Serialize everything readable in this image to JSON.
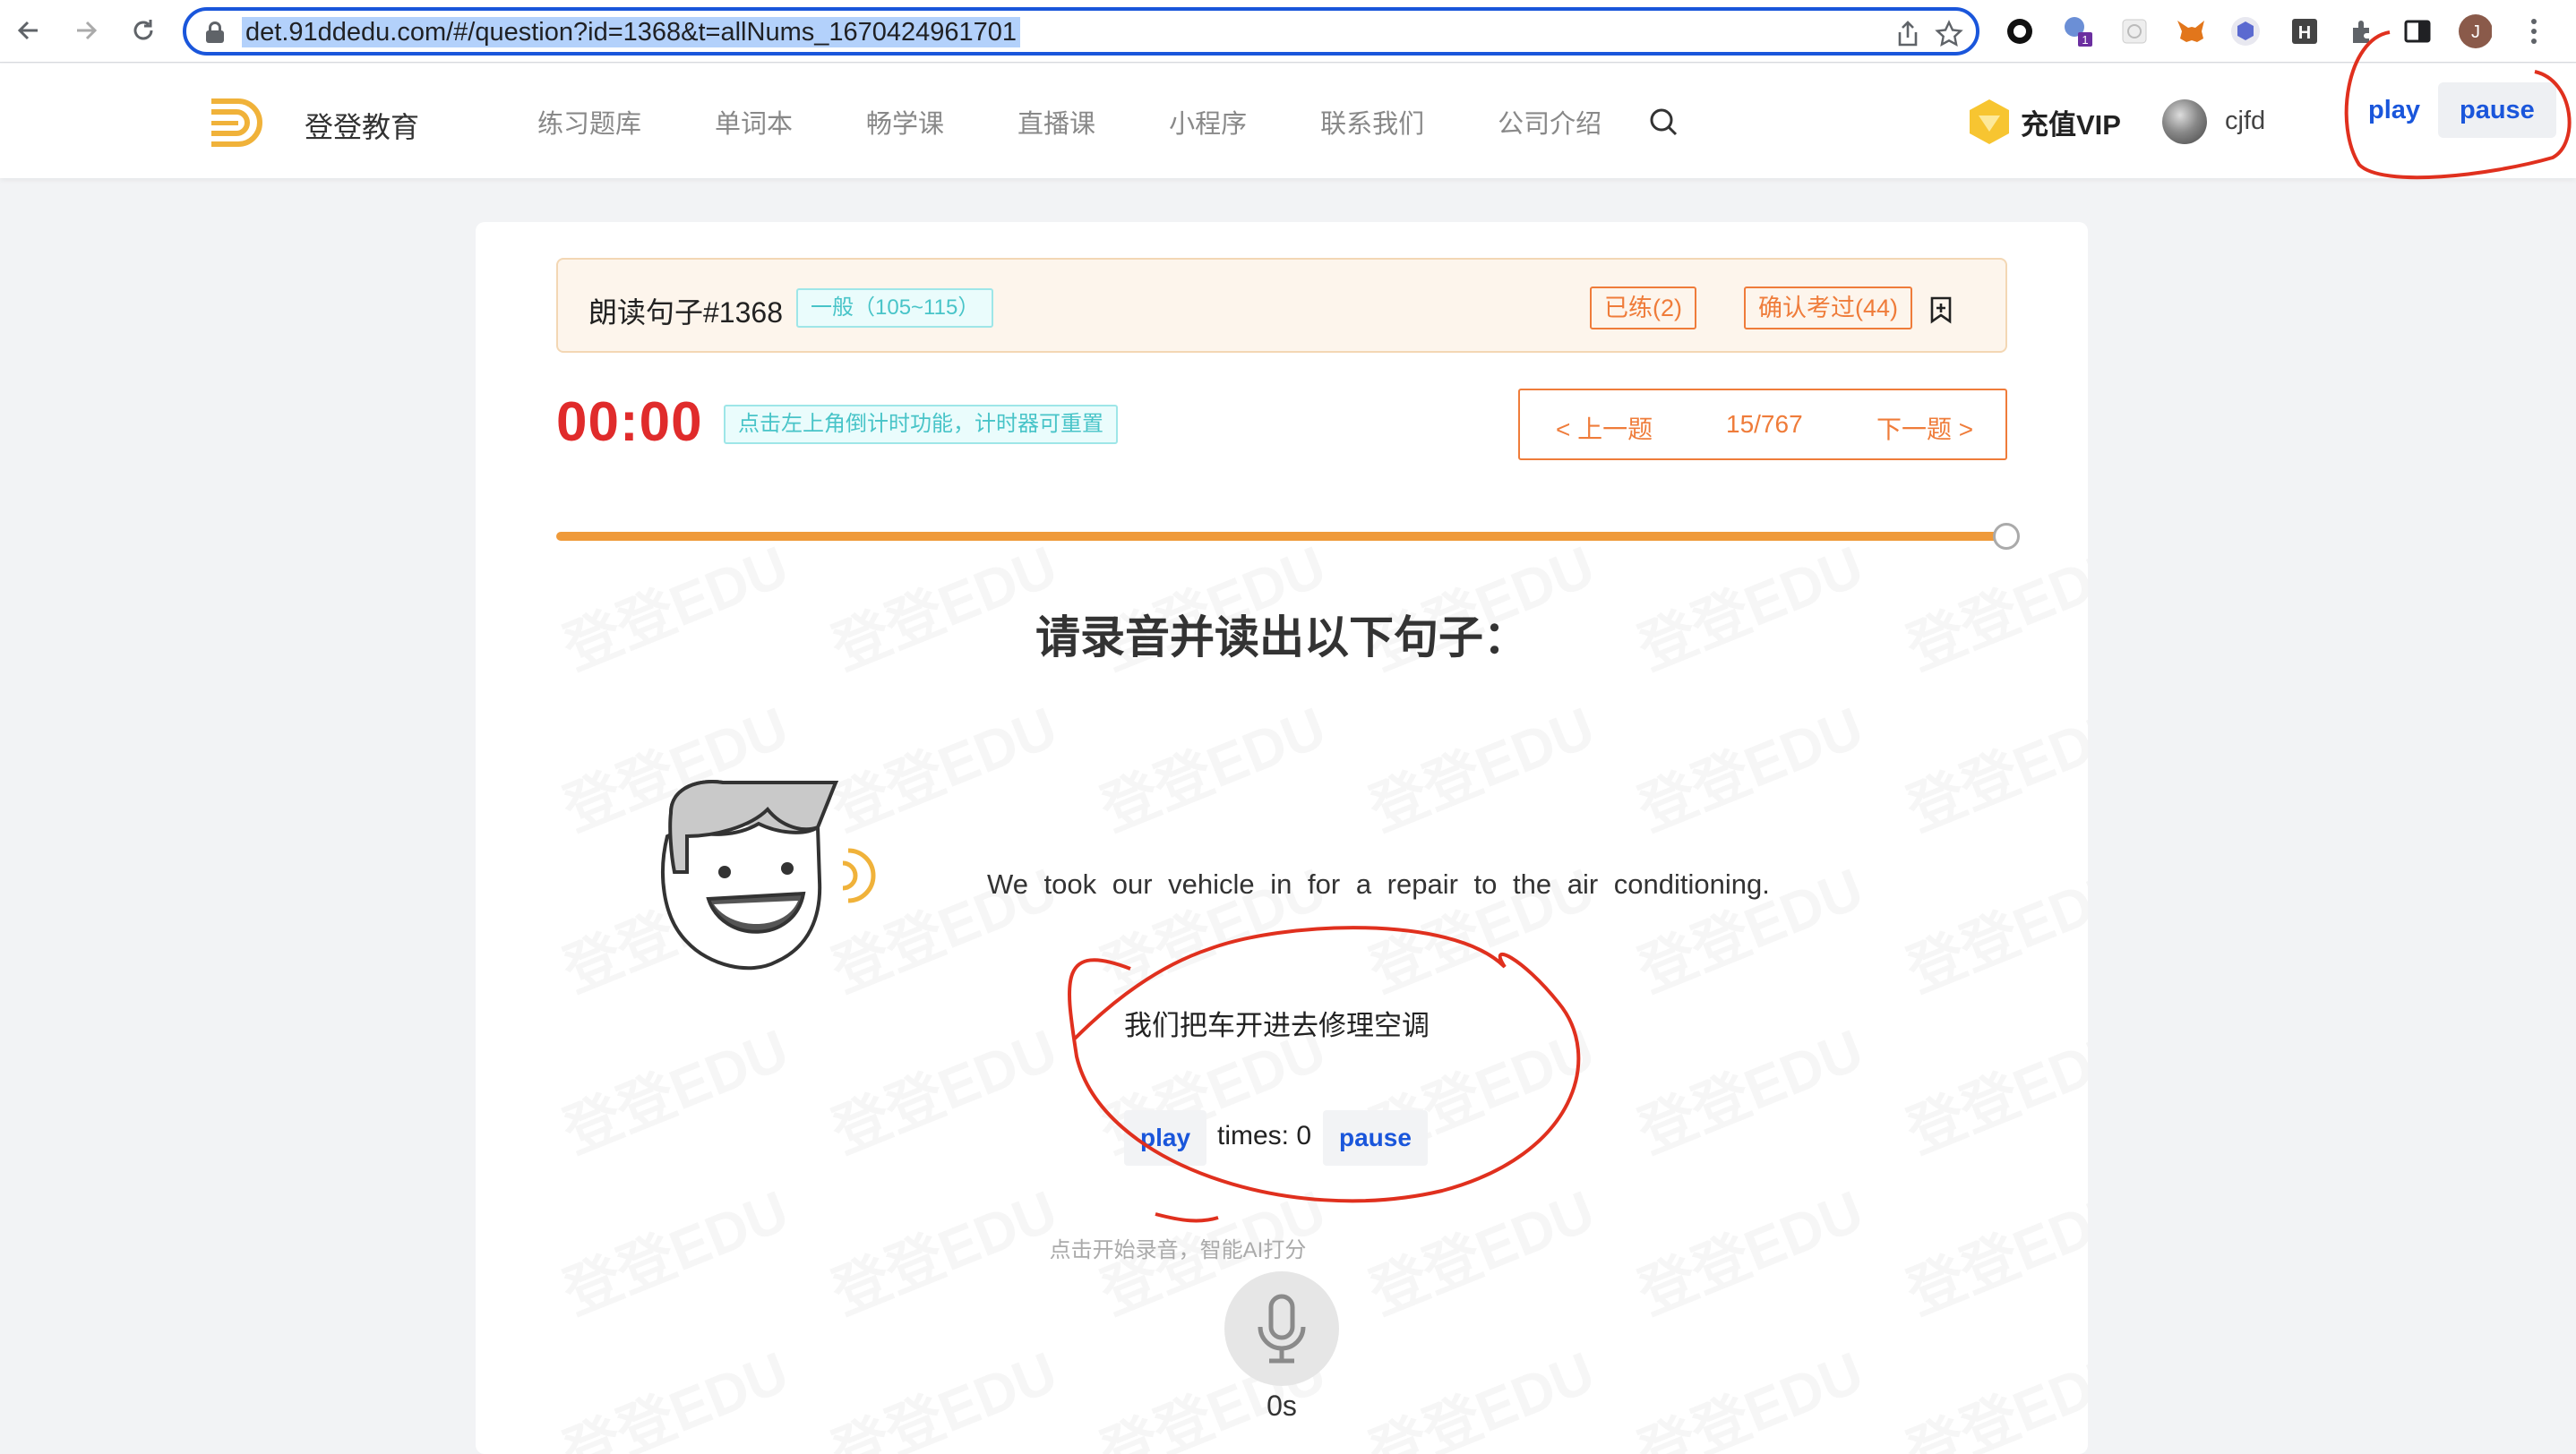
{
  "browser": {
    "url": "det.91ddedu.com/#/question?id=1368&t=allNums_1670424961701",
    "profile_initial": "J",
    "extensions": [
      "obs-icon",
      "translate-icon",
      "puzzle-ext-icon",
      "metamask-icon",
      "hex-ext-icon",
      "h-ext-icon",
      "extensions-icon",
      "sidepanel-icon"
    ],
    "translate_badge": "1"
  },
  "site": {
    "brand": "登登教育",
    "nav": [
      "练习题库",
      "单词本",
      "畅学课",
      "直播课",
      "小程序",
      "联系我们",
      "公司介绍"
    ],
    "vip_label": "充值VIP",
    "username": "cjfd",
    "top_play": "play",
    "top_pause": "pause"
  },
  "question": {
    "title": "朗读句子#1368",
    "level": "一般（105~115）",
    "practiced": "已练(2)",
    "confirmed": "确认考过(44)",
    "timer": "00:00",
    "timer_hint": "点击左上角倒计时功能，计时器可重置",
    "prev": "< 上一题",
    "position": "15/767",
    "next": "下一题 >",
    "progress": 1.0,
    "prompt": "请录音并读出以下句子：",
    "sentence": "We took our vehicle in for a repair to the air conditioning.",
    "translation": "我们把车开进去修理空调",
    "play_label": "play",
    "times_label": "times: 0",
    "pause_label": "pause",
    "record_hint": "点击开始录音，智能AI打分",
    "duration": "0s"
  },
  "watermark": "登登EDU",
  "colors": {
    "accent": "#ef7c3a",
    "timer": "#e02b2b",
    "link": "#1a56db",
    "teal": "#48c4c8",
    "annotation": "#e0301e"
  }
}
